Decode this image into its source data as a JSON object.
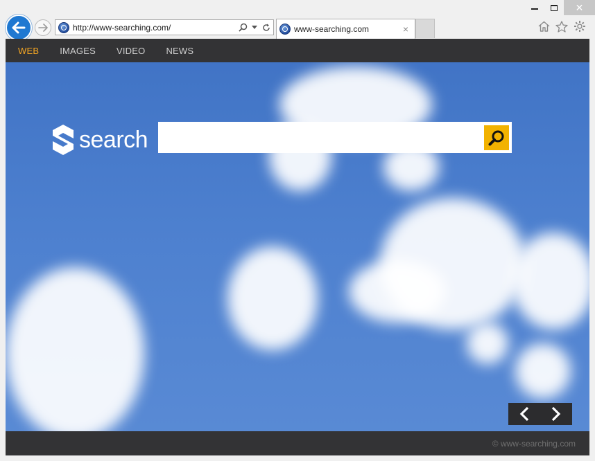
{
  "browser": {
    "address": "http://www-searching.com/",
    "tab_title": "www-searching.com",
    "tab_close": "×",
    "close_glyph": "✕"
  },
  "nav": {
    "items": [
      {
        "label": "WEB",
        "active": true
      },
      {
        "label": "IMAGES",
        "active": false
      },
      {
        "label": "VIDEO",
        "active": false
      },
      {
        "label": "NEWS",
        "active": false
      }
    ]
  },
  "logo": {
    "text": "search"
  },
  "search": {
    "value": "",
    "placeholder": ""
  },
  "footer": {
    "copyright": "© www-searching.com"
  },
  "colors": {
    "accent": "#f4a623",
    "search_button": "#f2b200",
    "nav_bar": "#333335",
    "back_button": "#1f78d1"
  },
  "icons": {
    "back": "arrow-left-icon",
    "forward": "arrow-right-icon",
    "search": "magnifier-icon",
    "refresh": "refresh-icon",
    "home": "home-icon",
    "favorites": "star-icon",
    "settings": "gear-icon",
    "prev": "chevron-left-icon",
    "next": "chevron-right-icon"
  }
}
